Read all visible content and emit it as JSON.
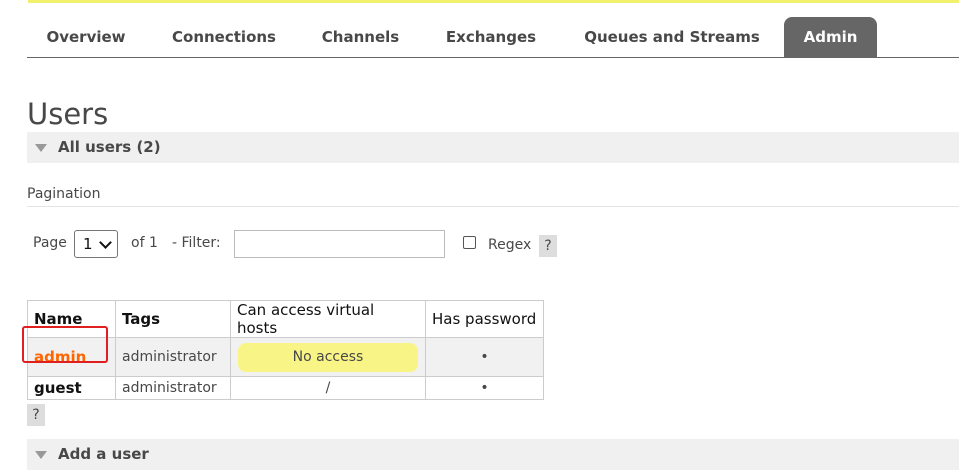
{
  "nav": {
    "tabs": [
      {
        "label": "Overview"
      },
      {
        "label": "Connections"
      },
      {
        "label": "Channels"
      },
      {
        "label": "Exchanges"
      },
      {
        "label": "Queues and Streams"
      },
      {
        "label": "Admin",
        "active": true
      }
    ]
  },
  "page": {
    "title": "Users"
  },
  "all_users": {
    "label": "All users (2)"
  },
  "pagination": {
    "label": "Pagination",
    "page_label": "Page",
    "page_value": "1",
    "of_label": "of 1",
    "filter_label": "- Filter:",
    "filter_value": "",
    "regex_label": "Regex",
    "help": "?"
  },
  "table": {
    "headers": [
      "Name",
      "Tags",
      "Can access virtual hosts",
      "Has password"
    ],
    "rows": [
      {
        "name": "admin",
        "tags": "administrator",
        "vhosts": "No access",
        "has_password": "•"
      },
      {
        "name": "guest",
        "tags": "administrator",
        "vhosts": "/",
        "has_password": "•"
      }
    ]
  },
  "table_help": "?",
  "add_user": {
    "label": "Add a user"
  },
  "colors": {
    "accent_link": "#ff6600",
    "active_tab": "#666666",
    "no_access_bg": "#f8f586",
    "highlight": "#e02020"
  }
}
